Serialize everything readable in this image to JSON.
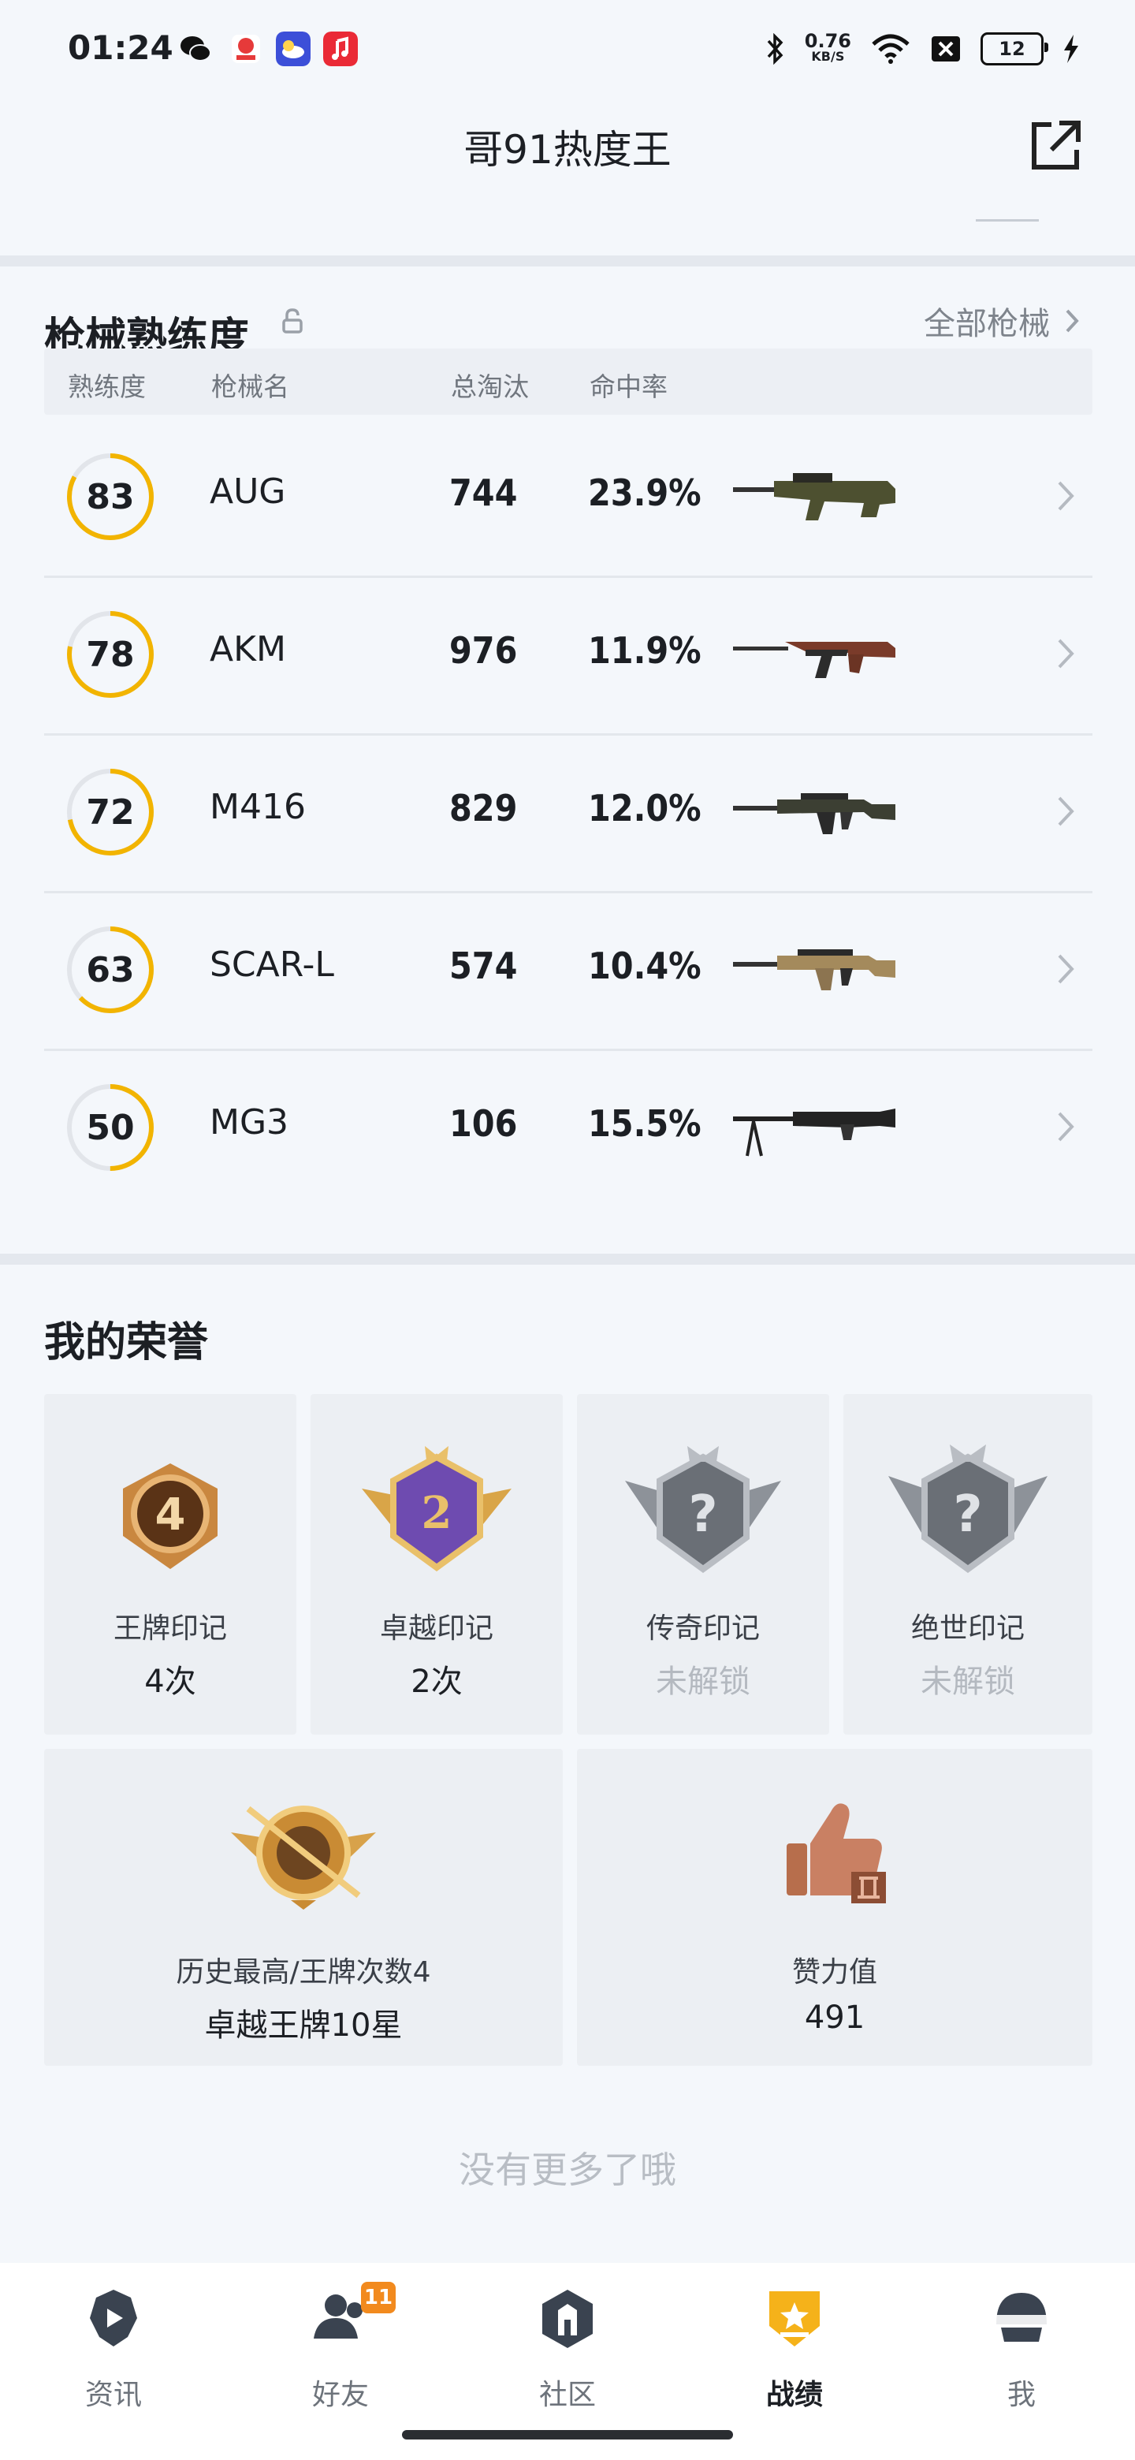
{
  "status_bar": {
    "time": "01:24",
    "net_speed_value": "0.76",
    "net_speed_unit": "KB/S",
    "battery": "12",
    "icons": [
      "wechat-icon",
      "app-icon",
      "weather-icon",
      "music-icon",
      "bluetooth-icon",
      "wifi-icon",
      "sim-off-icon",
      "charging-icon"
    ]
  },
  "header": {
    "title": "哥91热度王",
    "share_icon": "share-external-icon"
  },
  "weapons": {
    "section_title": "枪械熟练度",
    "all_label": "全部枪械",
    "columns": [
      "熟练度",
      "枪械名",
      "总淘汰",
      "命中率"
    ],
    "accent_color": "#f2b400",
    "rows": [
      {
        "proficiency": "83",
        "proficiency_value": 83,
        "name": "AUG",
        "kills": "744",
        "hit_rate": "23.9%"
      },
      {
        "proficiency": "78",
        "proficiency_value": 78,
        "name": "AKM",
        "kills": "976",
        "hit_rate": "11.9%"
      },
      {
        "proficiency": "72",
        "proficiency_value": 72,
        "name": "M416",
        "kills": "829",
        "hit_rate": "12.0%"
      },
      {
        "proficiency": "63",
        "proficiency_value": 63,
        "name": "SCAR-L",
        "kills": "574",
        "hit_rate": "10.4%"
      },
      {
        "proficiency": "50",
        "proficiency_value": 50,
        "name": "MG3",
        "kills": "106",
        "hit_rate": "15.5%"
      }
    ]
  },
  "honors": {
    "section_title": "我的荣誉",
    "tiles": [
      {
        "name": "王牌印记",
        "value": "4次",
        "emblem_text": "4"
      },
      {
        "name": "卓越印记",
        "value": "2次",
        "emblem_text": "2"
      },
      {
        "name": "传奇印记",
        "value": "未解锁",
        "emblem_text": "?"
      },
      {
        "name": "绝世印记",
        "value": "未解锁",
        "emblem_text": "?"
      }
    ],
    "wide_tiles": [
      {
        "name": "历史最高/王牌次数4",
        "value": "卓越王牌10星"
      },
      {
        "name": "赞力值",
        "value": "491"
      }
    ]
  },
  "footer_text": "没有更多了哦",
  "bottom_nav": {
    "items": [
      {
        "label": "资讯",
        "icon": "news-icon"
      },
      {
        "label": "好友",
        "icon": "friends-icon",
        "badge": "11"
      },
      {
        "label": "社区",
        "icon": "community-icon"
      },
      {
        "label": "战绩",
        "icon": "stats-icon",
        "active": true
      },
      {
        "label": "我",
        "icon": "profile-helmet-icon"
      }
    ]
  }
}
